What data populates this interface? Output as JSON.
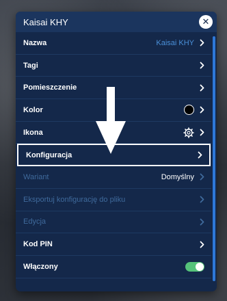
{
  "dialog": {
    "title": "Kaisai KHY",
    "close_label": "✕"
  },
  "rows": [
    {
      "label": "Nazwa",
      "value": "Kaisai KHY"
    },
    {
      "label": "Tagi"
    },
    {
      "label": "Pomieszczenie"
    },
    {
      "label": "Kolor",
      "icon": "color-circle-icon",
      "swatch": "#000000"
    },
    {
      "label": "Ikona",
      "icon": "gear-settings-icon"
    },
    {
      "label": "Konfiguracja",
      "highlighted": true
    },
    {
      "label": "Wariant",
      "value": "Domyślny",
      "disabled": true
    },
    {
      "label": "Eksportuj konfigurację do pliku",
      "disabled": true
    },
    {
      "label": "Edycja",
      "disabled": true
    },
    {
      "label": "Kod PIN"
    },
    {
      "label": "Włączony",
      "toggle": true
    }
  ],
  "colors": {
    "dialog_bg": "#14284a",
    "header_bg": "#1b355e",
    "accent_blue": "#4a90d9",
    "toggle_on": "#55c27a"
  },
  "annotation": {
    "icon": "down-arrow-icon"
  }
}
